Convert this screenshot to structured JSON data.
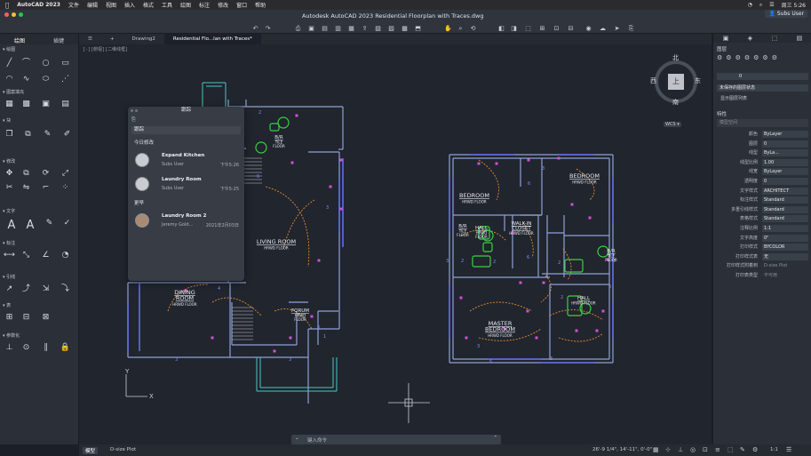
{
  "menubar": {
    "app": "AutoCAD 2023",
    "items": [
      "文件",
      "编辑",
      "视图",
      "插入",
      "格式",
      "工具",
      "绘图",
      "标注",
      "修改",
      "窗口",
      "帮助"
    ],
    "clock": "周三 5:26"
  },
  "titlebar": {
    "title": "Autodesk AutoCAD 2023   Residential Floorplan with Traces.dwg",
    "user": "Subs User"
  },
  "leftpanel": {
    "tabs": [
      "绘图",
      "插键"
    ],
    "sections": [
      "绘图",
      "图案填充",
      "块",
      "修改",
      "文字",
      "标注",
      "引线",
      "表",
      "参数化"
    ]
  },
  "doctabs": {
    "items": [
      "Drawing2",
      "Residential Flo...lan with Traces*"
    ]
  },
  "canvas": {
    "viewlabel": "[-][俯视][二维线框]",
    "viewcube": {
      "n": "北",
      "s": "南",
      "e": "东",
      "w": "西",
      "top": "上",
      "ucs": "WCS ▾"
    },
    "axis_x": "X",
    "axis_y": "Y",
    "rooms": [
      {
        "name": "LIVING  ROOM",
        "sub": "HRWD  FLOOR"
      },
      {
        "name": "DINING",
        "name2": "ROOM",
        "sub": "HRWD  FLOOR"
      },
      {
        "name": "FORUM",
        "sub": "HRWD",
        "sub2": "FLOOR"
      },
      {
        "name": "B/R",
        "sub": "TILE",
        "sub2": "FLOOR"
      },
      {
        "name": "BEDROOM",
        "sub": "HRWD  FLOOR"
      },
      {
        "name": "BEDROOM",
        "sub": "HRWD  FLOOR"
      },
      {
        "name": "WALK-IN",
        "name2": "CLOSET",
        "sub": "HRWD  FLOOR"
      },
      {
        "name": "HALL",
        "sub": "HRWD",
        "sub2": "FLOOR"
      },
      {
        "name": "B/R",
        "sub": "TILE",
        "sub2": "FLOOR"
      },
      {
        "name": "B/R",
        "sub": "TILE",
        "sub2": "FLOOR"
      },
      {
        "name": "MASTER",
        "name2": "BEDROOM",
        "sub": "HRWD  FLOOR"
      },
      {
        "name": "HALL",
        "sub": "HRWD  FLOOR"
      }
    ]
  },
  "trace": {
    "title": "跟踪",
    "header": "跟踪",
    "group1": "今日修改",
    "group2": "更早",
    "items": [
      {
        "name": "Expand Kitchen",
        "user": "Subs User",
        "time": "下午5:26"
      },
      {
        "name": "Laundry Room",
        "user": "Subs User",
        "time": "下午5:25"
      },
      {
        "name": "Laundry Room 2",
        "user": "Jeremy Gold...",
        "time": "2021年2月03日"
      }
    ]
  },
  "rightpanel": {
    "layers_title": "图层",
    "layer_value": "0",
    "layer_state": "未保存的图层状态",
    "layer_list": "显示图层列表",
    "props_title": "特性",
    "props_tab": "模型空间",
    "props": [
      {
        "k": "颜色",
        "v": "ByLayer"
      },
      {
        "k": "图层",
        "v": "0"
      },
      {
        "k": "线型",
        "v": "ByLa..."
      },
      {
        "k": "线型比例",
        "v": "1.00"
      },
      {
        "k": "线宽",
        "v": "ByLayer"
      },
      {
        "k": "透明度",
        "v": "0"
      },
      {
        "k": "文字样式",
        "v": "ARCHITECT"
      },
      {
        "k": "标注样式",
        "v": "Standard"
      },
      {
        "k": "多重引线样式",
        "v": "Standard"
      },
      {
        "k": "表格样式",
        "v": "Standard"
      },
      {
        "k": "注释比例",
        "v": "1:1"
      },
      {
        "k": "文字高度",
        "v": "0\""
      },
      {
        "k": "打印样式",
        "v": "BYCOLOR"
      },
      {
        "k": "打印样式表",
        "v": "无"
      },
      {
        "k": "打印样式附着到",
        "v": "D-size Plot"
      },
      {
        "k": "打印表类型",
        "v": "不可用"
      }
    ]
  },
  "status": {
    "model": "模型",
    "layout": "D-size Plot",
    "cmd_placeholder": "键入命令",
    "coords": "26'-9 1/4\", 14'-11\", 0'-0\"",
    "scale": "1:1"
  },
  "colors": {
    "wall": "#8fa1d6",
    "tag": "#d44fd4",
    "elec": "#e38a2e",
    "fixture": "#39d046",
    "stair": "#c9ccd1",
    "number": "#4f6af0",
    "window": "#49c7c2"
  }
}
